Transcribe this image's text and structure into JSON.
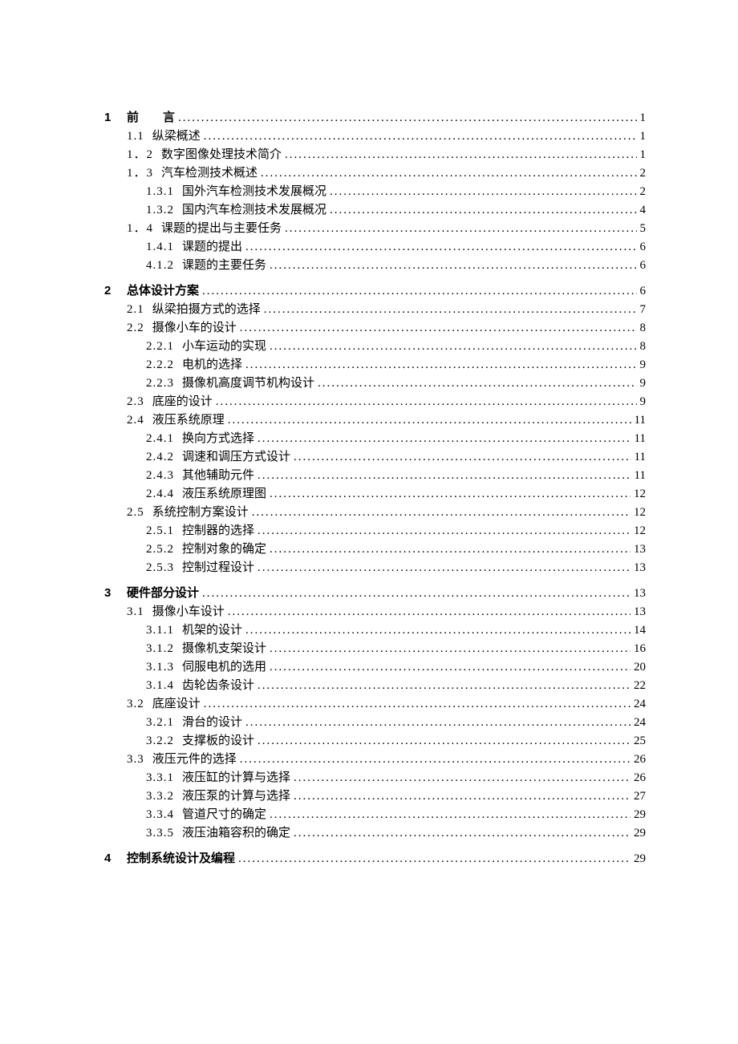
{
  "toc": [
    {
      "type": "chapter",
      "chapnum": "1",
      "num": "",
      "title": "前　　言",
      "page": "1"
    },
    {
      "type": "section",
      "num": "1.1",
      "title": "纵梁概述",
      "page": "1"
    },
    {
      "type": "section",
      "num": "1．2",
      "title": "数字图像处理技术简介",
      "page": "1"
    },
    {
      "type": "section",
      "num": "1．3",
      "title": "汽车检测技术概述",
      "page": "2"
    },
    {
      "type": "subsection",
      "num": "1.3.1",
      "title": "国外汽车检测技术发展概况",
      "page": "2"
    },
    {
      "type": "subsection",
      "num": "1.3.2",
      "title": "国内汽车检测技术发展概况",
      "page": "4"
    },
    {
      "type": "section",
      "num": "1．4",
      "title": "课题的提出与主要任务",
      "page": "5"
    },
    {
      "type": "subsection",
      "num": "1.4.1",
      "title": "课题的提出",
      "page": "6"
    },
    {
      "type": "subsection",
      "num": "4.1.2",
      "title": "课题的主要任务",
      "page": "6"
    },
    {
      "type": "chapter",
      "chapnum": "2",
      "num": "",
      "title": "总体设计方案",
      "page": "6"
    },
    {
      "type": "section",
      "num": "2.1",
      "title": "纵梁拍摄方式的选择",
      "page": "7"
    },
    {
      "type": "section",
      "num": "2.2",
      "title": "摄像小车的设计",
      "page": "8"
    },
    {
      "type": "subsection",
      "num": "2.2.1",
      "title": "小车运动的实现",
      "page": "8"
    },
    {
      "type": "subsection",
      "num": "2.2.2",
      "title": "电机的选择",
      "page": "9"
    },
    {
      "type": "subsection",
      "num": "2.2.3",
      "title": "摄像机高度调节机构设计",
      "page": "9"
    },
    {
      "type": "section",
      "num": "2.3",
      "title": "底座的设计",
      "page": "9"
    },
    {
      "type": "section",
      "num": "2.4",
      "title": "液压系统原理",
      "page": "11"
    },
    {
      "type": "subsection",
      "num": "2.4.1",
      "title": "换向方式选择",
      "page": "11"
    },
    {
      "type": "subsection",
      "num": "2.4.2",
      "title": "调速和调压方式设计",
      "page": "11"
    },
    {
      "type": "subsection",
      "num": "2.4.3",
      "title": "其他辅助元件",
      "page": "11"
    },
    {
      "type": "subsection",
      "num": "2.4.4",
      "title": "液压系统原理图",
      "page": "12"
    },
    {
      "type": "section",
      "num": "2.5",
      "title": "系统控制方案设计",
      "page": "12"
    },
    {
      "type": "subsection",
      "num": "2.5.1",
      "title": "控制器的选择",
      "page": "12"
    },
    {
      "type": "subsection",
      "num": "2.5.2",
      "title": "控制对象的确定",
      "page": "13"
    },
    {
      "type": "subsection",
      "num": "2.5.3",
      "title": "控制过程设计",
      "page": "13"
    },
    {
      "type": "chapter",
      "chapnum": "3",
      "num": "",
      "title": "硬件部分设计",
      "page": "13"
    },
    {
      "type": "section",
      "num": "3.1",
      "title": "摄像小车设计",
      "page": "13"
    },
    {
      "type": "subsection",
      "num": "3.1.1",
      "title": "机架的设计",
      "page": "14"
    },
    {
      "type": "subsection",
      "num": "3.1.2",
      "title": "摄像机支架设计",
      "page": "16"
    },
    {
      "type": "subsection",
      "num": "3.1.3",
      "title": "伺服电机的选用",
      "page": "20"
    },
    {
      "type": "subsection",
      "num": "3.1.4",
      "title": "齿轮齿条设计",
      "page": "22"
    },
    {
      "type": "section",
      "num": "3.2",
      "title": "底座设计",
      "page": "24"
    },
    {
      "type": "subsection",
      "num": "3.2.1",
      "title": "滑台的设计",
      "page": "24"
    },
    {
      "type": "subsection",
      "num": "3.2.2",
      "title": "支撑板的设计",
      "page": "25"
    },
    {
      "type": "section",
      "num": "3.3",
      "title": "液压元件的选择",
      "page": "26"
    },
    {
      "type": "subsection",
      "num": "3.3.1",
      "title": "液压缸的计算与选择",
      "page": "26"
    },
    {
      "type": "subsection",
      "num": "3.3.2",
      "title": "液压泵的计算与选择",
      "page": "27"
    },
    {
      "type": "subsection",
      "num": "3.3.4",
      "title": "管道尺寸的确定",
      "page": "29"
    },
    {
      "type": "subsection",
      "num": "3.3.5",
      "title": "液压油箱容积的确定",
      "page": "29"
    },
    {
      "type": "chapter",
      "chapnum": "4",
      "num": "",
      "title": "控制系统设计及编程",
      "page": "29"
    }
  ]
}
